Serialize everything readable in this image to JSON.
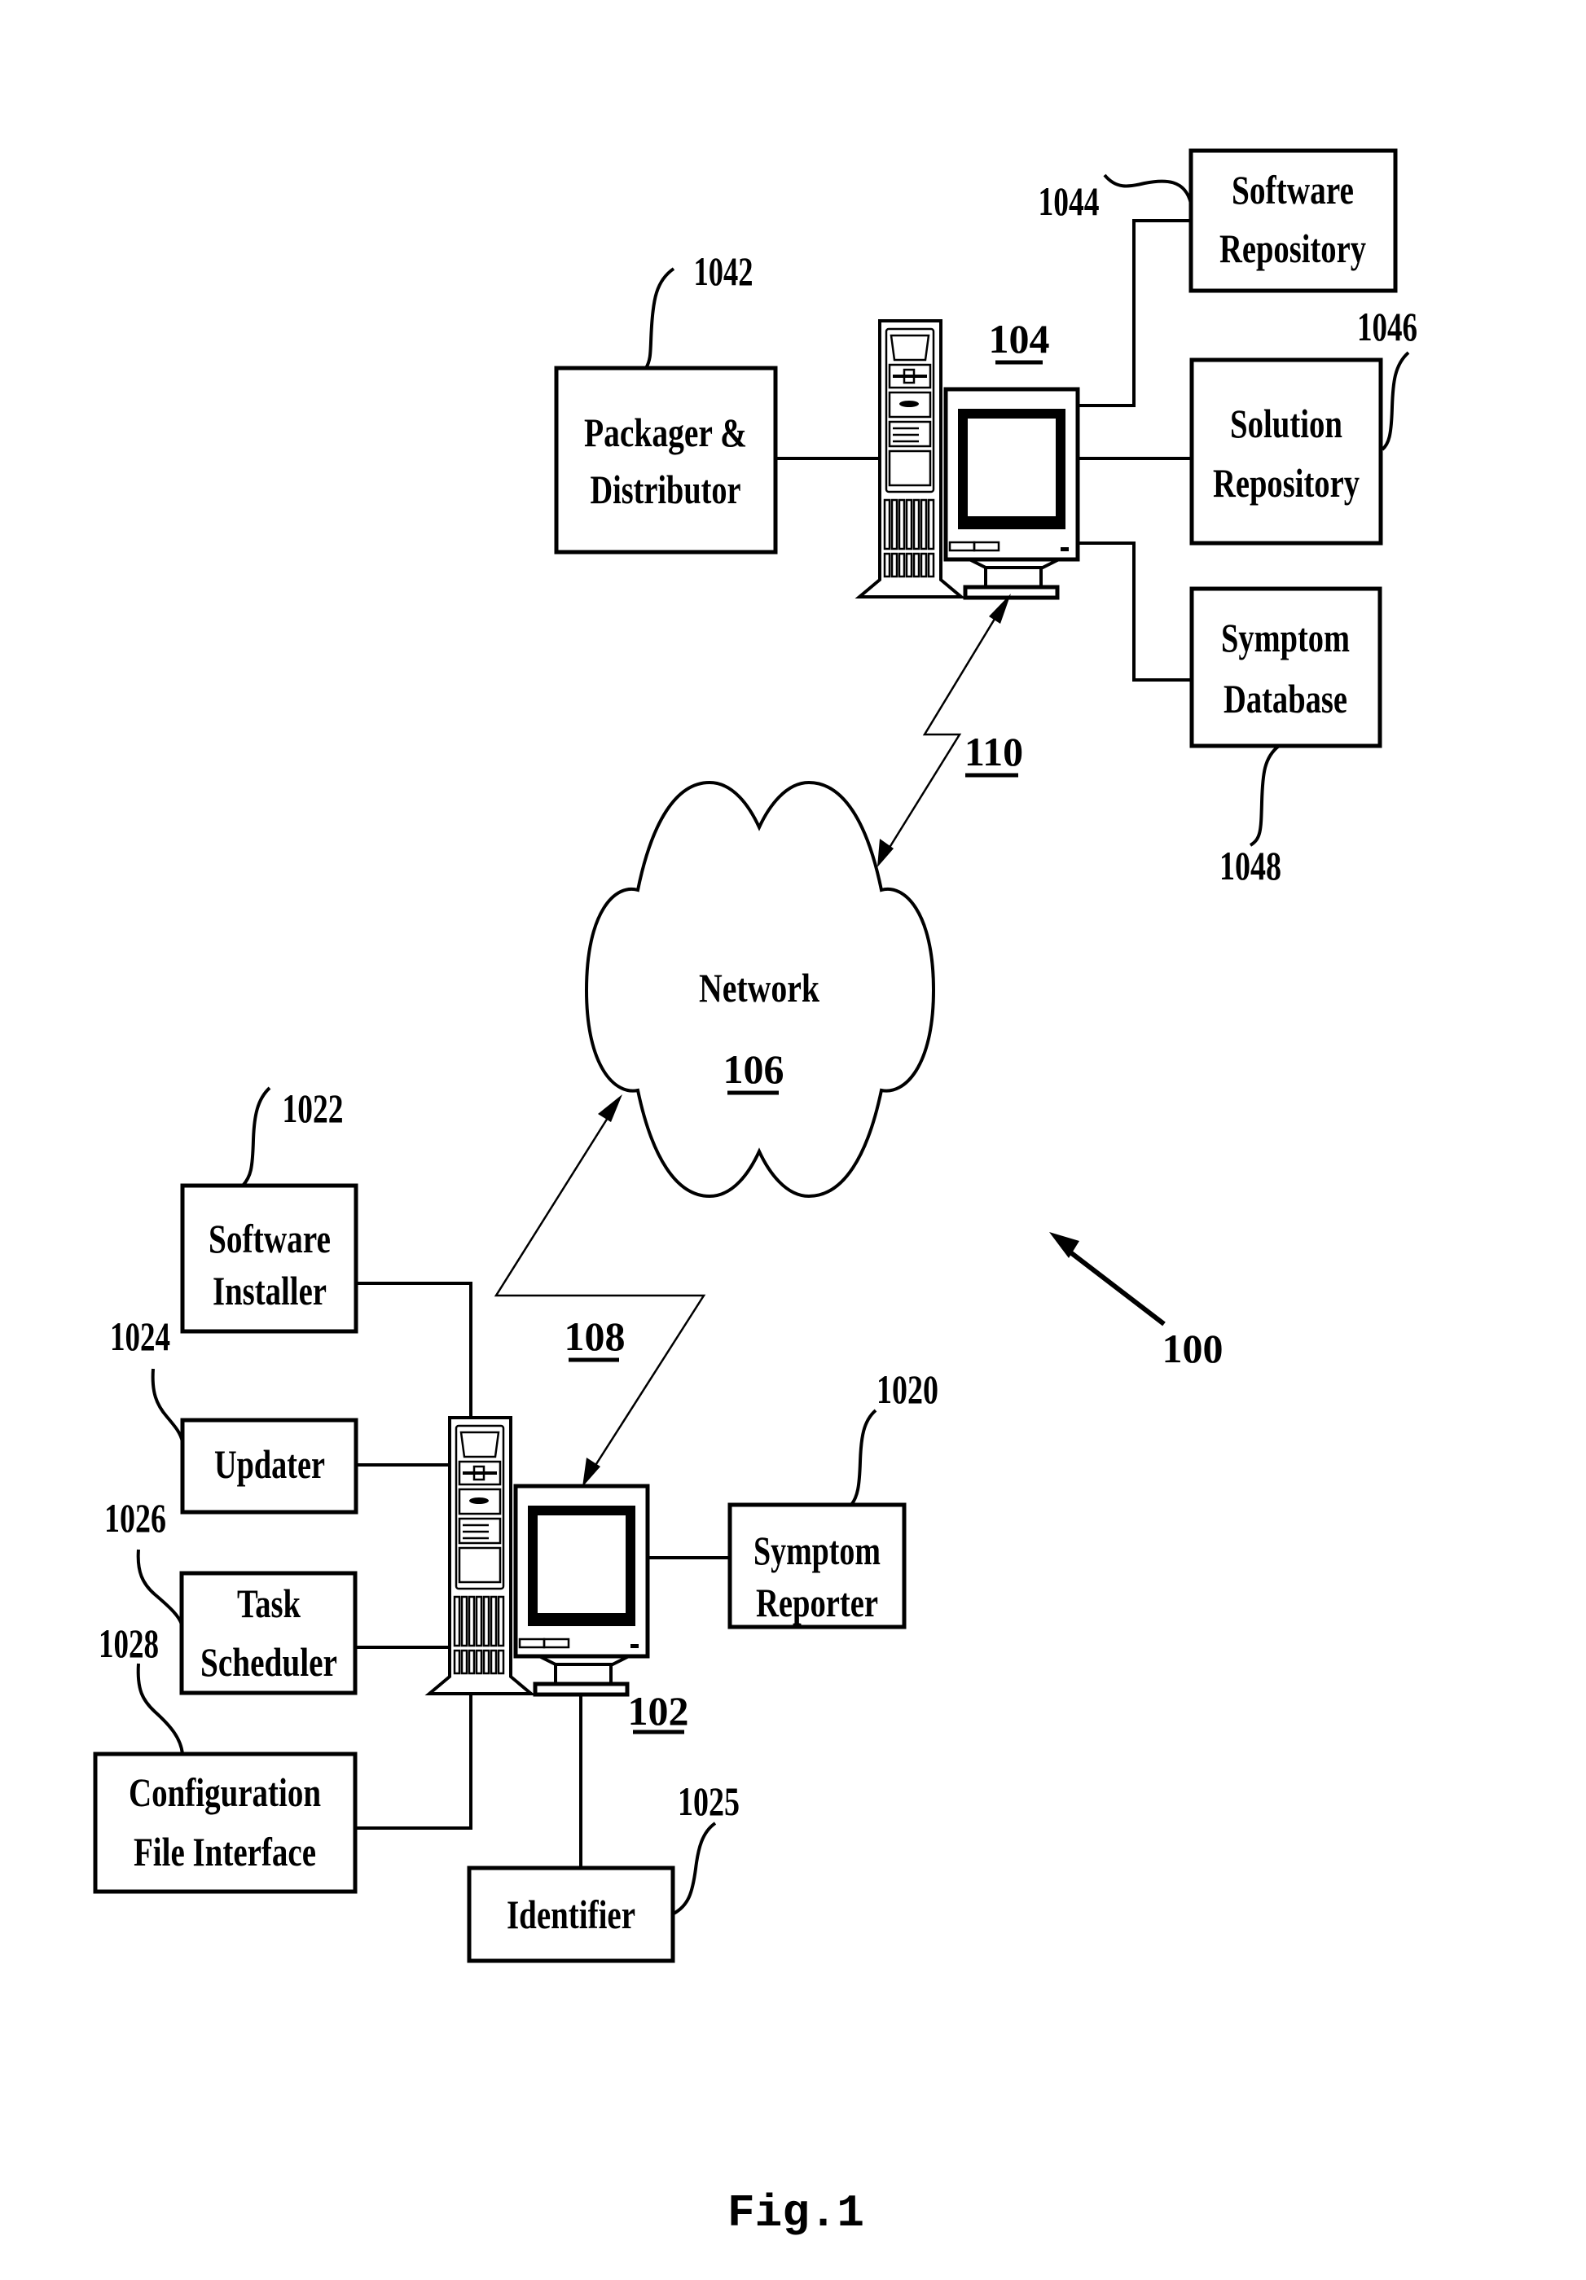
{
  "figure": {
    "caption": "Fig.1",
    "system_ref": "100"
  },
  "network": {
    "label": "Network",
    "ref": "106",
    "link_server_ref": "110",
    "link_client_ref": "108"
  },
  "server": {
    "ref": "104",
    "components": [
      {
        "id": "packager",
        "lines": [
          "Packager &",
          "Distributor"
        ],
        "ref": "1042"
      },
      {
        "id": "software-repository",
        "lines": [
          "Software",
          "Repository"
        ],
        "ref": "1044"
      },
      {
        "id": "solution-repository",
        "lines": [
          "Solution",
          "Repository"
        ],
        "ref": "1046"
      },
      {
        "id": "symptom-database",
        "lines": [
          "Symptom",
          "Database"
        ],
        "ref": "1048"
      }
    ]
  },
  "client": {
    "ref": "102",
    "components": [
      {
        "id": "software-installer",
        "lines": [
          "Software",
          "Installer"
        ],
        "ref": "1022"
      },
      {
        "id": "updater",
        "lines": [
          "Updater"
        ],
        "ref": "1024"
      },
      {
        "id": "task-scheduler",
        "lines": [
          "Task",
          "Scheduler"
        ],
        "ref": "1026"
      },
      {
        "id": "configuration-file-interface",
        "lines": [
          "Configuration",
          "File Interface"
        ],
        "ref": "1028"
      },
      {
        "id": "symptom-reporter",
        "lines": [
          "Symptom",
          "Reporter"
        ],
        "ref": "1020"
      },
      {
        "id": "identifier",
        "lines": [
          "Identifier"
        ],
        "ref": "1025"
      }
    ]
  }
}
